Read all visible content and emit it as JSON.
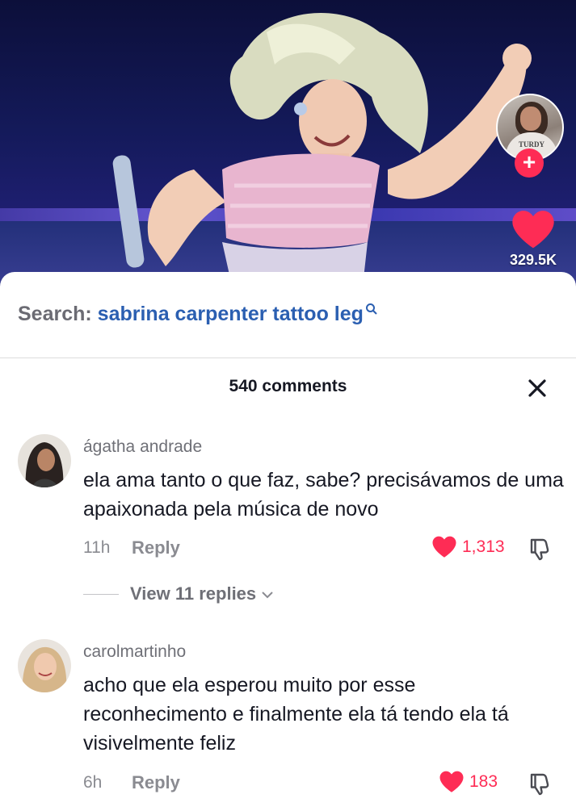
{
  "video": {
    "like_count": "329.5K",
    "creator_shirt_text": "TURDY"
  },
  "search": {
    "prefix": "Search:",
    "term": "sabrina carpenter tattoo leg"
  },
  "comments_header": {
    "count_label": "540 comments"
  },
  "comments": [
    {
      "author": "ágatha andrade",
      "text": "ela ama tanto o que faz, sabe? precisávamos de uma apaixonada pela música de novo",
      "time": "11h",
      "reply_label": "Reply",
      "likes": "1,313",
      "view_replies": "View 11 replies"
    },
    {
      "author": "carolmartinho",
      "text": "acho que ela esperou muito por esse reconhecimento e finalmente ela tá tendo ela tá visivelmente feliz",
      "time": "6h",
      "reply_label": "Reply",
      "likes": "183"
    }
  ],
  "colors": {
    "accent": "#fe2c55",
    "search_term": "#2b5fb1"
  }
}
